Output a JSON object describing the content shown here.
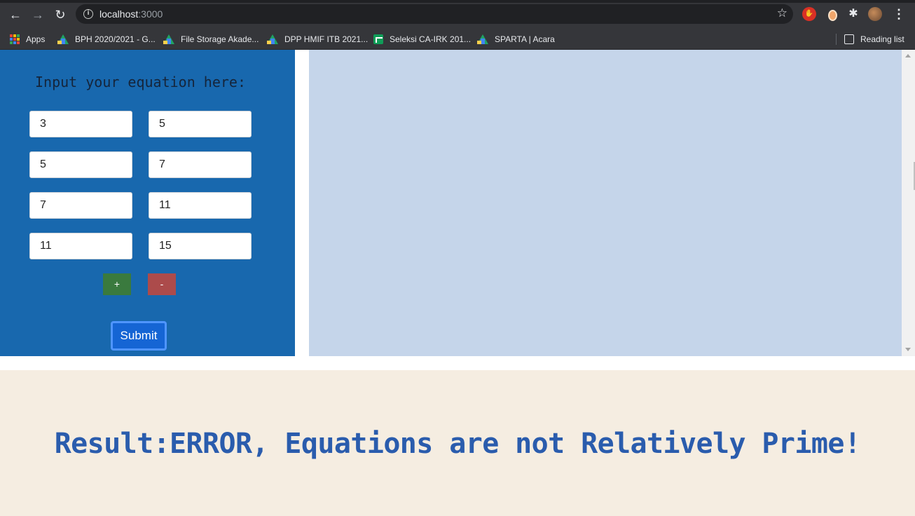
{
  "browser": {
    "url_host": "localhost",
    "url_port": ":3000",
    "bookmarks": [
      {
        "label": "Apps",
        "icon": "apps-grid-icon"
      },
      {
        "label": "BPH 2020/2021 - G...",
        "icon": "google-drive-icon"
      },
      {
        "label": "File Storage Akade...",
        "icon": "google-drive-icon"
      },
      {
        "label": "DPP HMIF ITB 2021...",
        "icon": "google-drive-icon"
      },
      {
        "label": "Seleksi CA-IRK 201...",
        "icon": "google-sheets-icon"
      },
      {
        "label": "SPARTA | Acara",
        "icon": "google-drive-icon"
      }
    ],
    "reading_list": "Reading list"
  },
  "form": {
    "title": "Input your equation here:",
    "rows": [
      {
        "a": "3",
        "m": "5"
      },
      {
        "a": "5",
        "m": "7"
      },
      {
        "a": "7",
        "m": "11"
      },
      {
        "a": "11",
        "m": "15"
      }
    ],
    "add_label": "+",
    "remove_label": "-",
    "submit_label": "Submit"
  },
  "result": {
    "text": "Result:ERROR, Equations are not Relatively Prime!"
  },
  "colors": {
    "left_panel": "#1868ae",
    "right_panel": "#c5d5ea",
    "result_bg": "#f5ede1",
    "result_text": "#2a5cad",
    "plus_button": "#3a7a3e",
    "minus_button": "#ac4b4b",
    "submit_button": "#1565d4"
  }
}
